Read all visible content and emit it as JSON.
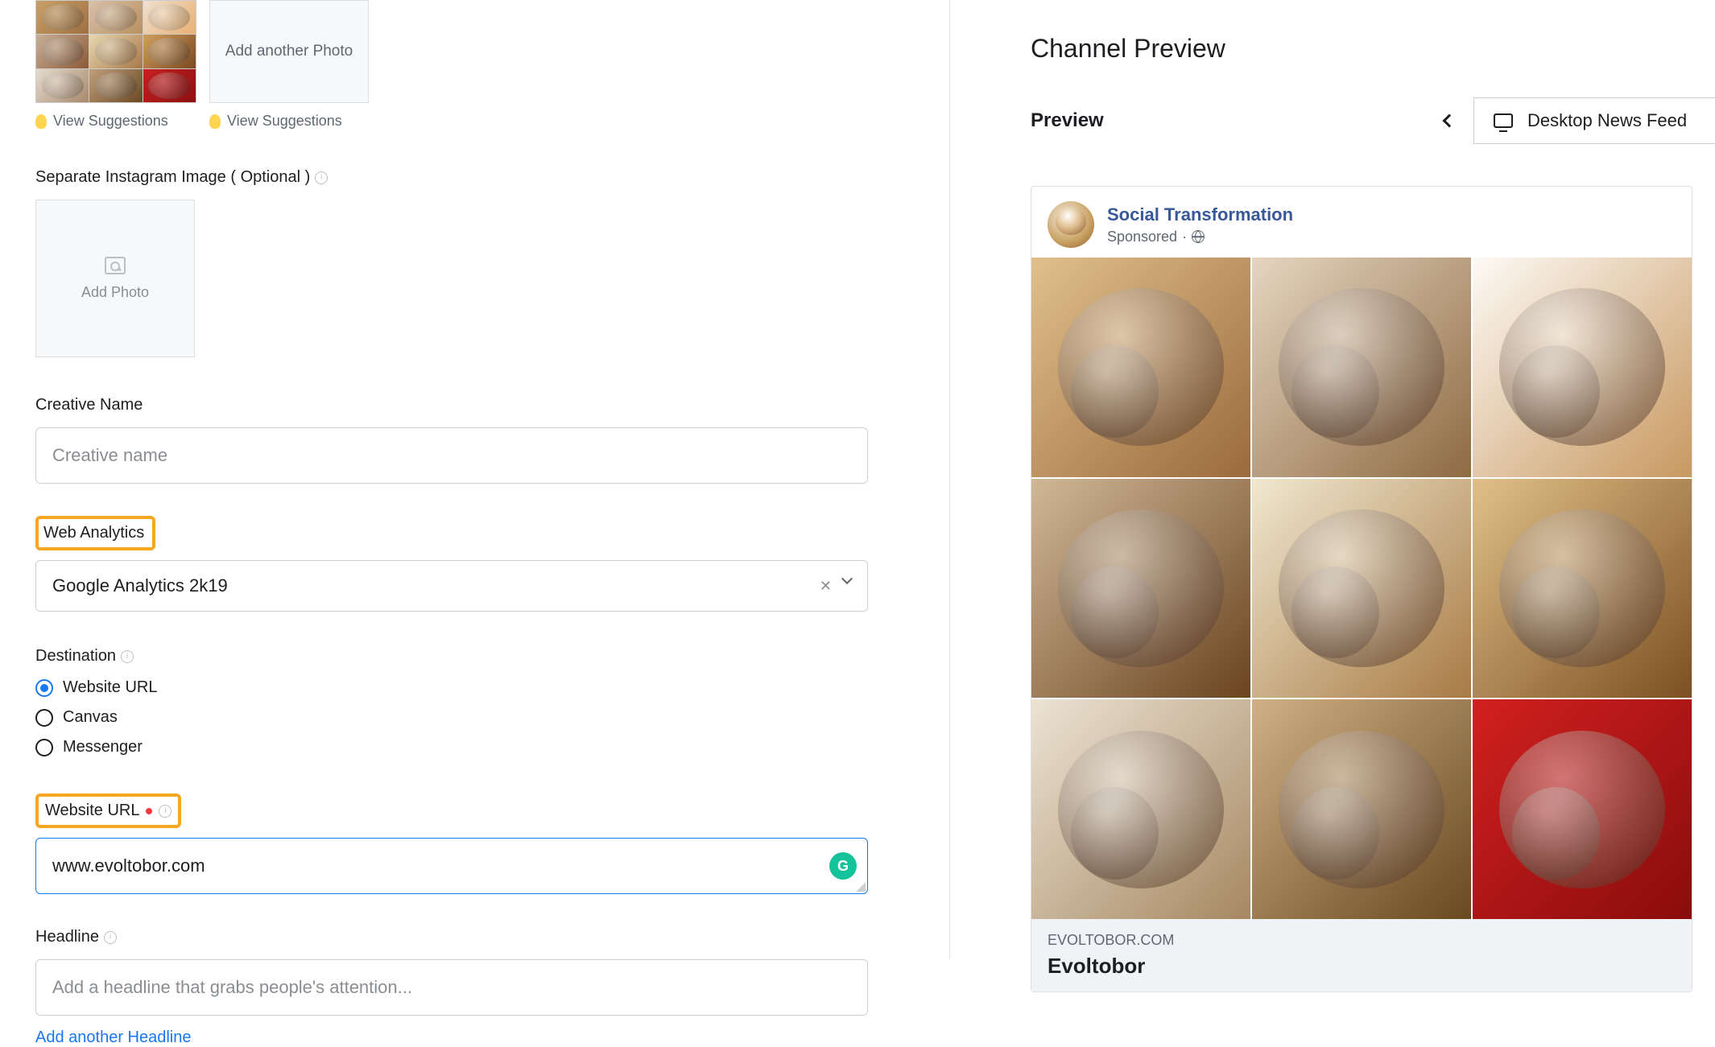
{
  "thumbnails": {
    "add_another_label": "Add another Photo",
    "view_suggestions_label": "View Suggestions"
  },
  "instagram_image": {
    "label": "Separate Instagram Image ( Optional )",
    "add_photo_label": "Add Photo"
  },
  "creative_name": {
    "label": "Creative Name",
    "placeholder": "Creative name"
  },
  "web_analytics": {
    "label": "Web Analytics",
    "value": "Google Analytics 2k19"
  },
  "destination": {
    "label": "Destination",
    "options": [
      "Website URL",
      "Canvas",
      "Messenger"
    ],
    "selected": 0
  },
  "website_url": {
    "label": "Website URL",
    "value": "www.evoltobor.com"
  },
  "headline": {
    "label": "Headline",
    "placeholder": "Add a headline that grabs people's attention...",
    "add_another_label": "Add another Headline"
  },
  "preview": {
    "channel_title": "Channel Preview",
    "preview_label": "Preview",
    "device_option": "Desktop News Feed",
    "ad": {
      "page_name": "Social Transformation",
      "sponsored_label": "Sponsored",
      "domain": "EVOLTOBOR.COM",
      "title": "Evoltobor"
    }
  }
}
